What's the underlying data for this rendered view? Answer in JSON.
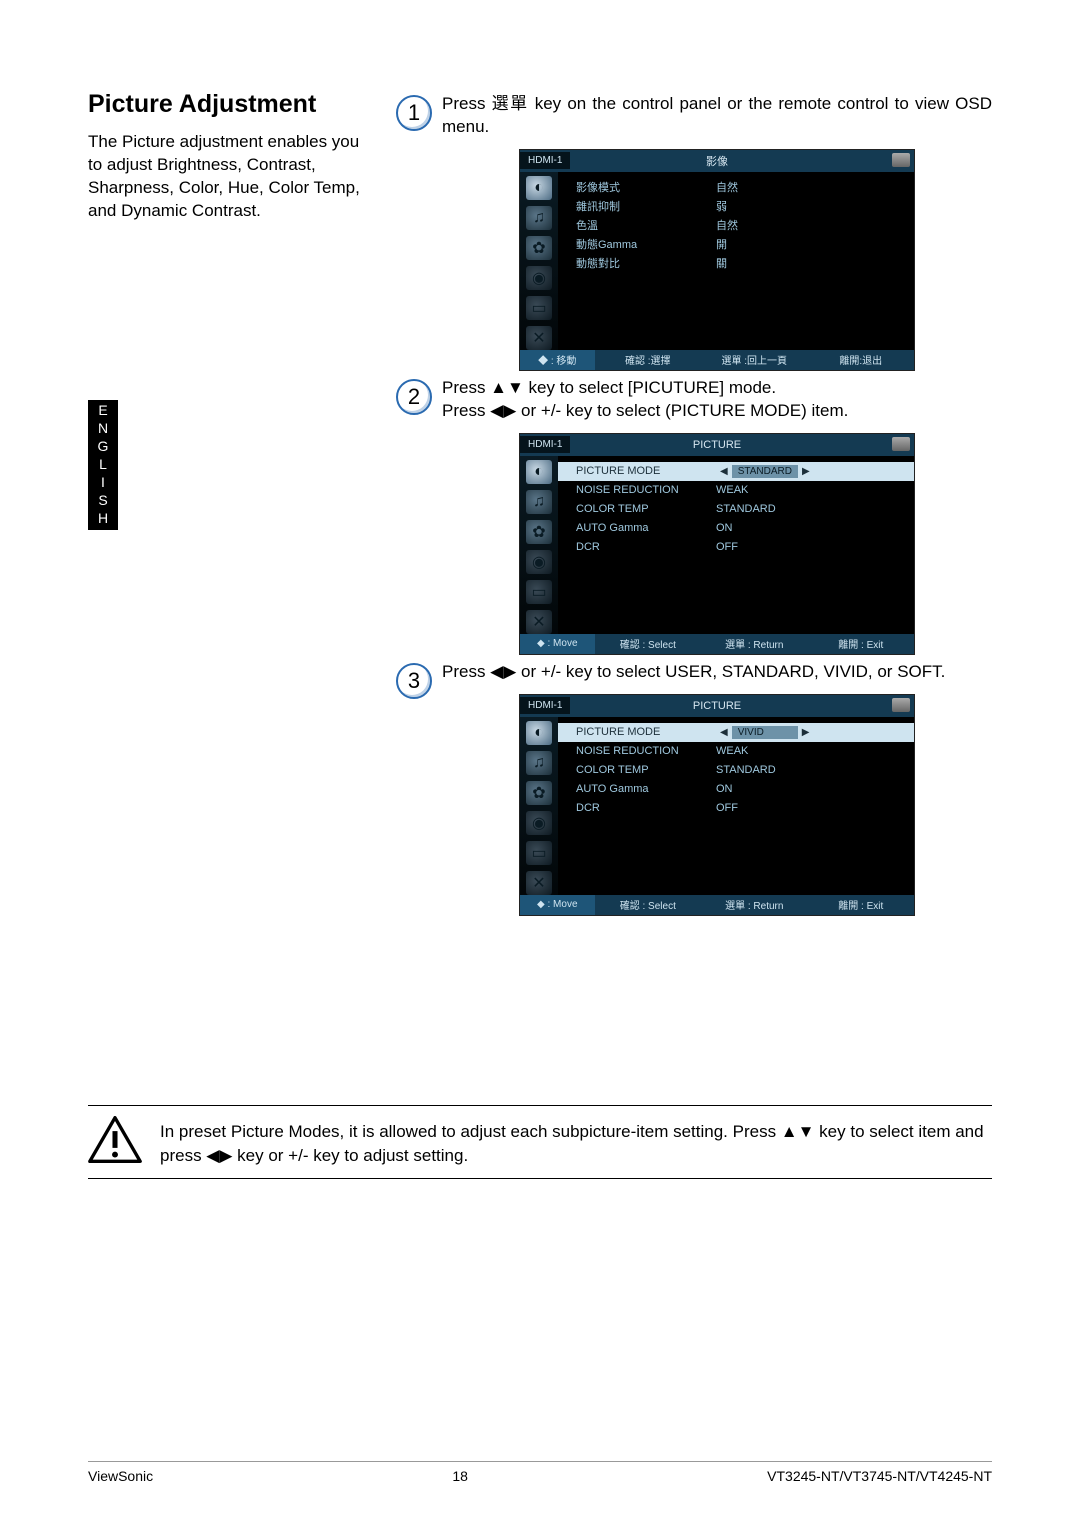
{
  "section": {
    "title": "Picture Adjustment",
    "intro": "The Picture adjustment enables you to adjust Brightness, Contrast, Sharpness, Color, Hue, Color Temp, and Dynamic Contrast."
  },
  "side_tab": "ENGLISH",
  "steps": {
    "s1": {
      "num": "1",
      "text": "Press 選單 key on the control panel or the remote control to view OSD menu."
    },
    "s2": {
      "num": "2",
      "text_line1": "Press ▲▼ key to select [PICUTURE] mode.",
      "text_line2": "Press ◀▶ or +/- key to select (PICTURE MODE) item."
    },
    "s3": {
      "num": "3",
      "text": "Press ◀▶ or +/- key to select USER, STANDARD, VIVID, or SOFT."
    }
  },
  "osd1": {
    "source": "HDMI-1",
    "title": "影像",
    "rows": [
      {
        "label": "影像模式",
        "value": "自然"
      },
      {
        "label": "雜訊抑制",
        "value": "弱"
      },
      {
        "label": "色溫",
        "value": "自然"
      },
      {
        "label": "動態Gamma",
        "value": "開"
      },
      {
        "label": "動態對比",
        "value": "關"
      }
    ],
    "footer": {
      "c1": "◆ : 移動",
      "c2": "確認 :選擇",
      "c3": "選單 :回上一頁",
      "c4": "離開:退出"
    }
  },
  "osd2": {
    "source": "HDMI-1",
    "title": "PICTURE",
    "rows": [
      {
        "label": "PICTURE MODE",
        "value": "STANDARD",
        "highlight": true
      },
      {
        "label": "NOISE REDUCTION",
        "value": "WEAK"
      },
      {
        "label": "COLOR TEMP",
        "value": "STANDARD"
      },
      {
        "label": "AUTO Gamma",
        "value": "ON"
      },
      {
        "label": "DCR",
        "value": "OFF"
      }
    ],
    "footer": {
      "c1": "◆ : Move",
      "c2": "確認 : Select",
      "c3": "選單 : Return",
      "c4": "離開 : Exit"
    }
  },
  "osd3": {
    "source": "HDMI-1",
    "title": "PICTURE",
    "rows": [
      {
        "label": "PICTURE MODE",
        "value": "VIVID",
        "highlight": true
      },
      {
        "label": "NOISE REDUCTION",
        "value": "WEAK"
      },
      {
        "label": "COLOR TEMP",
        "value": "STANDARD"
      },
      {
        "label": "AUTO Gamma",
        "value": "ON"
      },
      {
        "label": "DCR",
        "value": "OFF"
      }
    ],
    "footer": {
      "c1": "◆ : Move",
      "c2": "確認 : Select",
      "c3": "選單 : Return",
      "c4": "離開 : Exit"
    }
  },
  "warning": "In preset Picture Modes, it is allowed to adjust each subpicture-item setting. Press ▲▼ key to select item and press ◀▶ key or +/- key to adjust setting.",
  "footer": {
    "left": "ViewSonic",
    "center": "18",
    "right": "VT3245-NT/VT3745-NT/VT4245-NT"
  }
}
